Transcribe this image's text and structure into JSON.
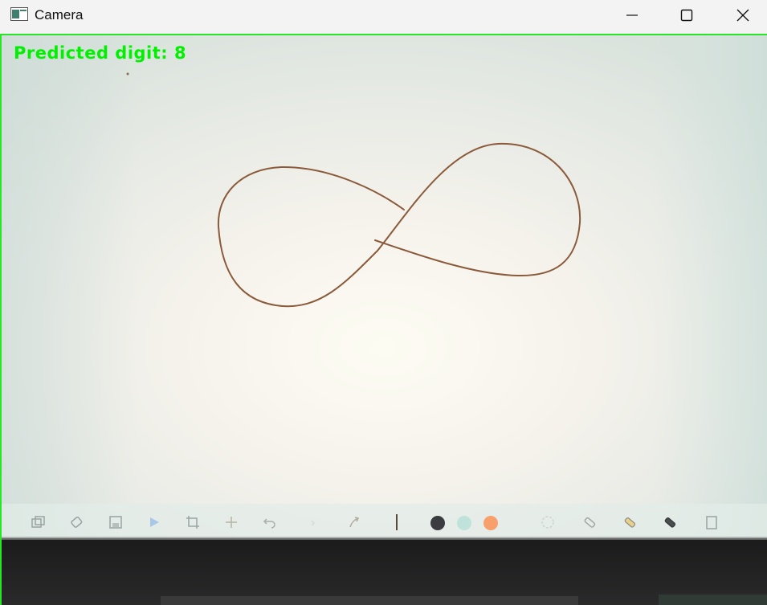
{
  "window": {
    "title": "Camera",
    "icon": "camera-app-icon",
    "controls": {
      "minimize_icon": "minimize-icon",
      "maximize_icon": "maximize-icon",
      "close_icon": "close-icon"
    }
  },
  "overlay": {
    "prediction_text": "Predicted digit: 8",
    "color": "#00f000",
    "frame_color": "#27e627"
  },
  "scene": {
    "description_icon": "hand-drawn-figure-eight",
    "stroke_color": "#8a5a3a",
    "toolbar_icons": [
      "layers-icon",
      "eraser-icon",
      "save-icon",
      "play-icon",
      "crop-icon",
      "move-icon",
      "undo-icon",
      "redo-icon",
      "redo-arrow-icon",
      "pen-separator-icon",
      "swatch-dark",
      "swatch-mint",
      "swatch-orange",
      "lasso-icon",
      "pencil-icon",
      "highlighter-icon",
      "marker-icon",
      "page-icon"
    ],
    "swatch_colors": [
      "#3a3c3f",
      "#bfe3db",
      "#f7a06c"
    ]
  }
}
